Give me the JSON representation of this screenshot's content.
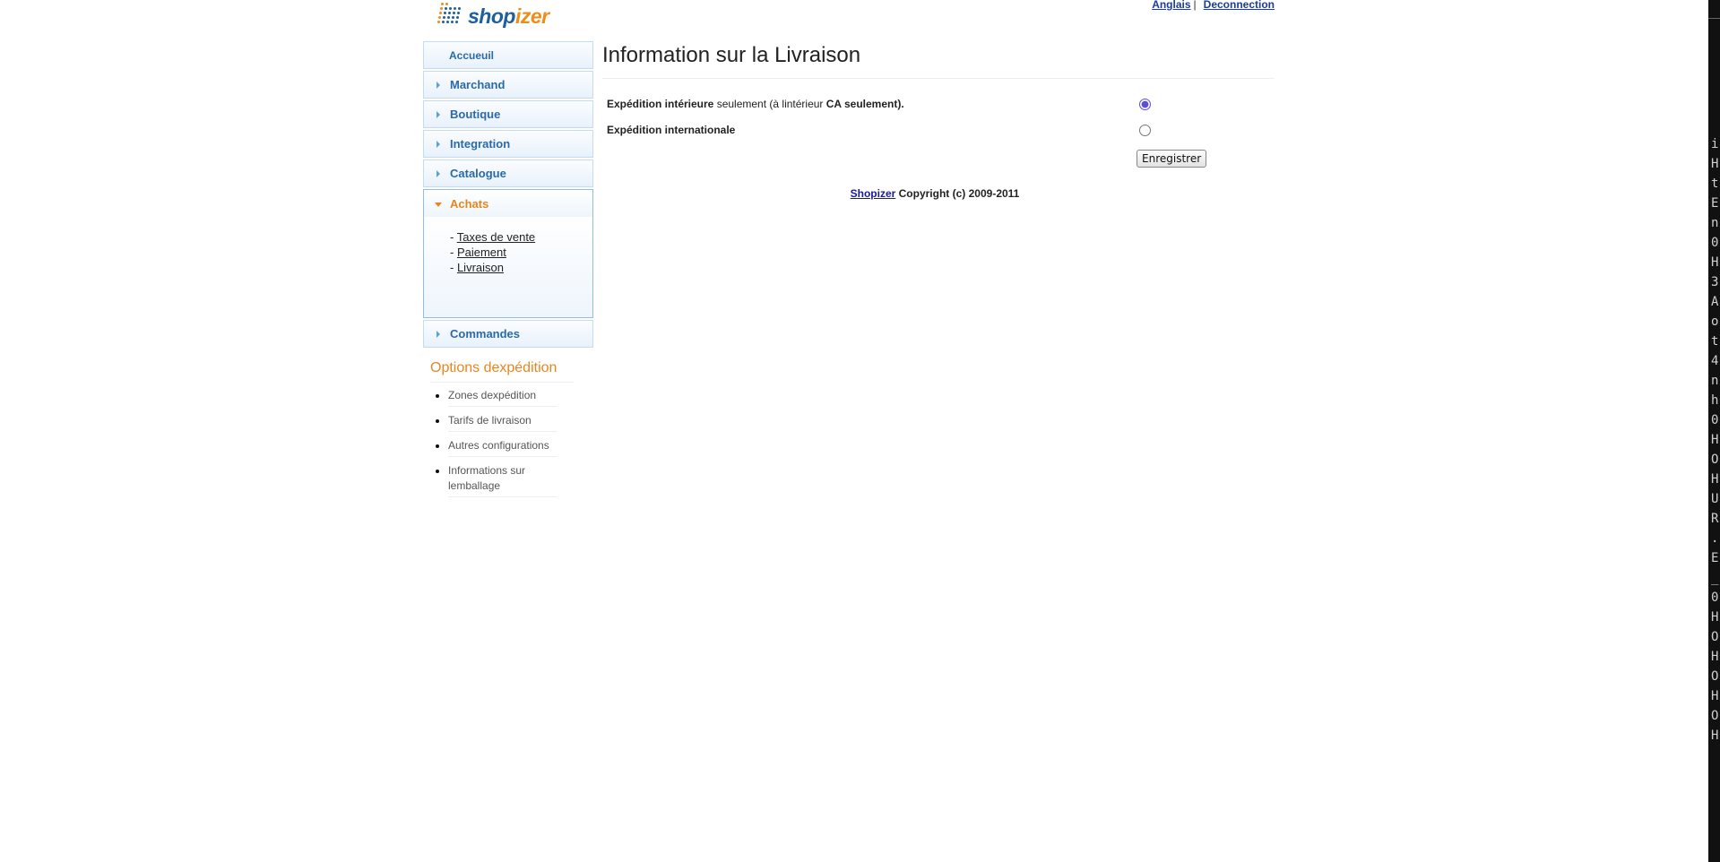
{
  "logo": {
    "part1": "shop",
    "part2": "izer"
  },
  "top_links": {
    "language": "Anglais",
    "separator": "|",
    "logout": "Deconnection"
  },
  "menu": {
    "home": "Accueuil",
    "items": [
      {
        "label": "Marchand"
      },
      {
        "label": "Boutique"
      },
      {
        "label": "Integration"
      },
      {
        "label": "Catalogue"
      }
    ],
    "active": {
      "label": "Achats",
      "sub": [
        {
          "prefix": "- ",
          "label": "Taxes de vente"
        },
        {
          "prefix": "- ",
          "label": "Paiement"
        },
        {
          "prefix": "- ",
          "label": "Livraison"
        }
      ]
    },
    "last": "Commandes"
  },
  "options": {
    "title": "Options dexpédition",
    "items": [
      "Zones dexpédition",
      "Tarifs de livraison",
      "Autres configurations",
      "Informations sur lemballage"
    ]
  },
  "main": {
    "title": "Information sur la Livraison",
    "domestic": {
      "bold1": "Expédition intérieure",
      "normal": " seulement (à lintérieur ",
      "bold2": "CA seulement).",
      "selected": true
    },
    "international": {
      "label": "Expédition internationale",
      "selected": false
    },
    "save_label": "Enregistrer"
  },
  "footer": {
    "link": "Shopizer",
    "text": " Copyright (c) 2009-2011"
  },
  "terminal": {
    "chars": "iHtEn0H3Aot4nh0HOHUR.E_0HOHOHOH"
  },
  "colors": {
    "accent_orange": "#e8861e",
    "menu_blue": "#2a6aa6",
    "radio_selected": "#5d4fd6"
  }
}
